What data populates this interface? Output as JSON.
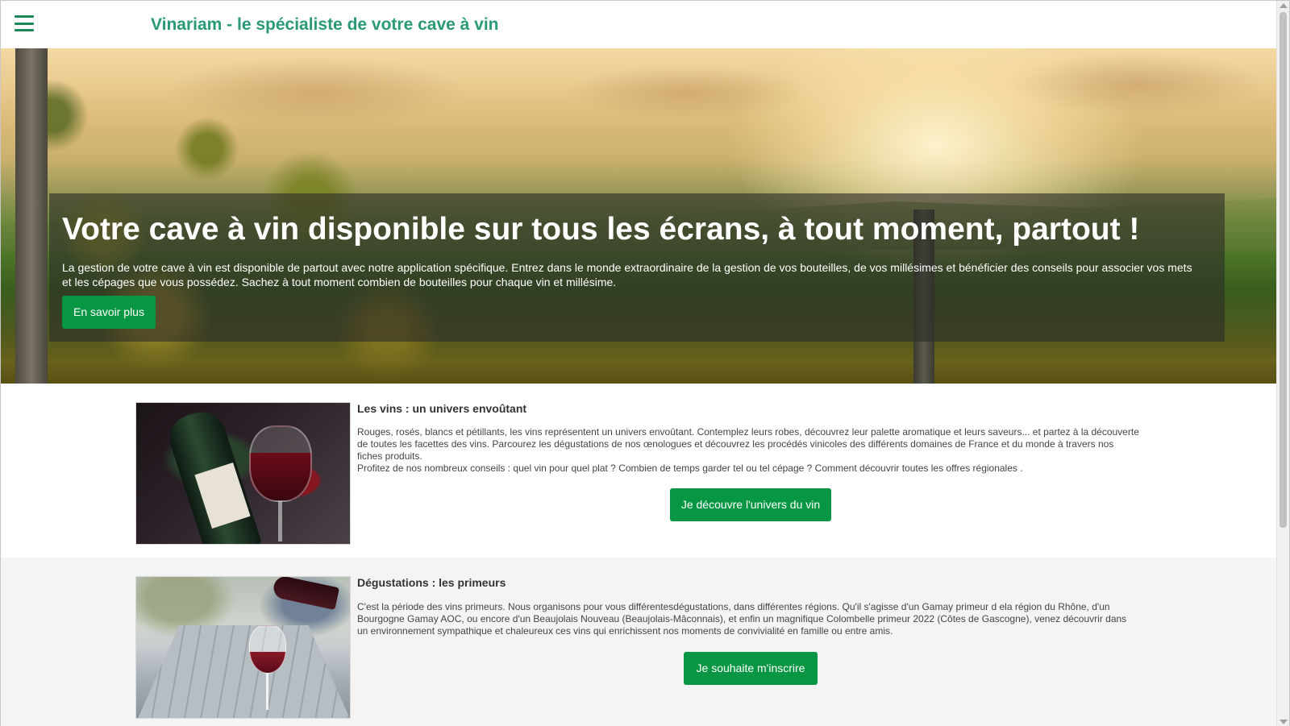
{
  "header": {
    "menu_icon": "hamburger-menu-icon",
    "site_title": "Vinariam - le spécialiste de votre cave à vin"
  },
  "hero": {
    "heading": "Votre cave à vin disponible sur tous les écrans, à tout moment, partout !",
    "text": "La gestion de votre cave à vin est disponible de partout avec notre application spécifique. Entrez dans le monde extraordinaire de la gestion de vos bouteilles, de vos millésimes et bénéficier des conseils pour associer vos mets et les cépages que vous possédez. Sachez à tout moment combien de bouteilles pour chaque vin et millésime.",
    "button_label": "En savoir plus"
  },
  "sections": [
    {
      "title": "Les vins : un univers envoûtant",
      "paragraph_1": "Rouges, rosés, blancs et pétillants, les vins représentent un univers envoûtant. Contemplez leurs robes, découvrez leur palette aromatique et leurs saveurs... et partez à la découverte de toutes les facettes des vins. Parcourez les dégustations de nos œnologues et découvrez les procédés vinicoles des différents domaines de France et du monde à travers nos fiches produits.",
      "paragraph_2": "Profitez de nos nombreux conseils : quel vin pour quel plat ? Combien de temps garder tel ou tel cépage ? Comment découvrir toutes les offres régionales .",
      "button_label": "Je découvre l'univers du vin"
    },
    {
      "title": "Dégustations : les primeurs",
      "paragraph_1": "C'est la période des vins primeurs. Nous organisons pour vous différentesdégustations, dans différentes régions. Qu'il s'agisse d'un Gamay primeur d ela région du Rhône, d'un Bourgogne Gamay AOC, ou encore d'un Beaujolais Nouveau (Beaujolais-Mâconnais), et enfin un magnifique Colombelle primeur 2022 (Côtes de Gascogne), venez découvrir dans un environnement sympathique et chaleureux ces vins qui enrichissent nos moments de convivialité en famille ou entre amis.",
      "button_label": "Je souhaite m'inscrire"
    }
  ],
  "colors": {
    "brand_green": "#079644",
    "title_teal": "#2a9a76"
  }
}
